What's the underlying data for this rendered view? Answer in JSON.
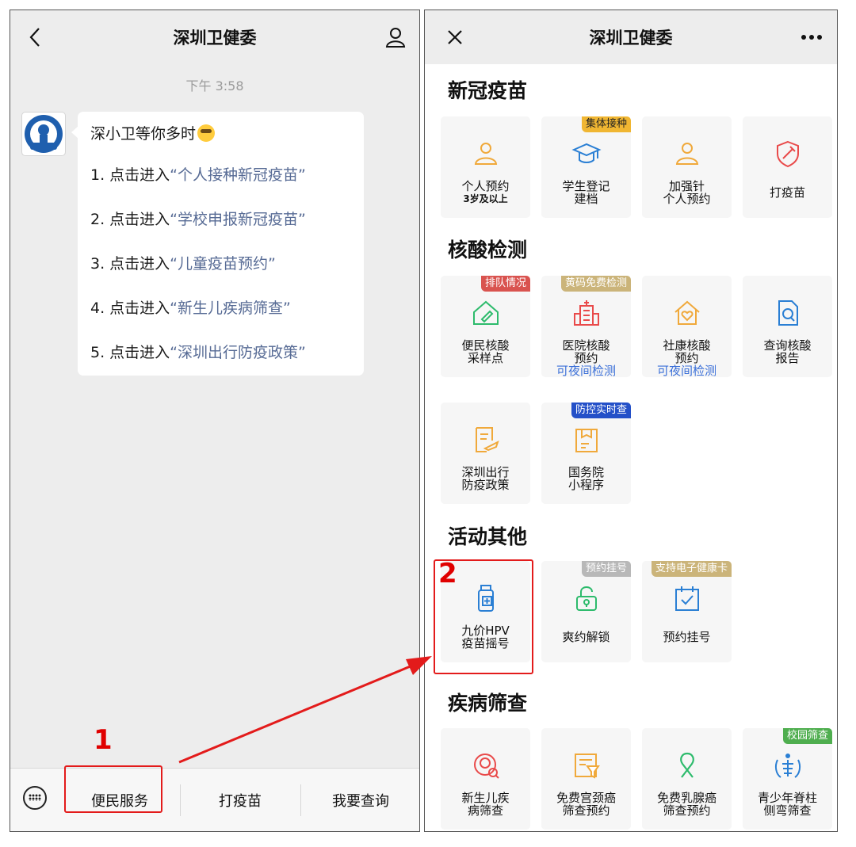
{
  "colors": {
    "accent_red": "#e31b1b",
    "link_blue": "#576b95",
    "icon_orange": "#f0a93b",
    "icon_blue": "#2a7fd4",
    "icon_red": "#e94a4a",
    "icon_green": "#2dbb6c"
  },
  "left": {
    "title": "深圳卫健委",
    "back_icon": "chevron-left-icon",
    "profile_icon": "person-icon",
    "timestamp": "下午 3:58",
    "message": {
      "greeting": "深小卫等你多时",
      "emoji": "sweat-smile-emoji",
      "lines": [
        {
          "prefix": "1. 点击进入",
          "link": "“个人接种新冠疫苗”"
        },
        {
          "prefix": "2. 点击进入",
          "link": "“学校申报新冠疫苗”"
        },
        {
          "prefix": "3. 点击进入",
          "link": "“儿童疫苗预约”"
        },
        {
          "prefix": "4. 点击进入",
          "link": "“新生儿疾病筛查”"
        },
        {
          "prefix": "5. 点击进入",
          "link": "“深圳出行防疫政策”"
        }
      ]
    },
    "menu": {
      "keyboard_icon": "keyboard-icon",
      "items": [
        "便民服务",
        "打疫苗",
        "我要查询"
      ]
    }
  },
  "right": {
    "title": "深圳卫健委",
    "close_icon": "close-icon",
    "more_icon": "more-icon",
    "sections": [
      {
        "title": "新冠疫苗",
        "tiles": [
          {
            "icon": "person-icon",
            "label": "个人预约",
            "sub": "3岁及以上"
          },
          {
            "icon": "graduation-cap-icon",
            "label": "学生登记",
            "label2": "建档",
            "badge": "集体接种"
          },
          {
            "icon": "person-icon",
            "label": "加强针",
            "label2": "个人预约"
          },
          {
            "icon": "vaccine-shield-icon",
            "label": "打疫苗"
          }
        ]
      },
      {
        "title": "核酸检测",
        "tiles": [
          {
            "icon": "house-pen-icon",
            "label": "便民核酸",
            "label2": "采样点",
            "badge": "排队情况"
          },
          {
            "icon": "hospital-icon",
            "label": "医院核酸",
            "label2": "预约",
            "note": "可夜间检测",
            "badge": "黄码免费检测"
          },
          {
            "icon": "home-heart-icon",
            "label": "社康核酸",
            "label2": "预约",
            "note": "可夜间检测"
          },
          {
            "icon": "document-search-icon",
            "label": "查询核酸",
            "label2": "报告"
          },
          {
            "icon": "travel-document-icon",
            "label": "深圳出行",
            "label2": "防疫政策"
          },
          {
            "icon": "mini-program-icon",
            "label": "国务院",
            "label2": "小程序",
            "badge": "防控实时查"
          }
        ]
      },
      {
        "title": "活动其他",
        "tiles": [
          {
            "icon": "vaccine-bottle-icon",
            "label": "九价HPV",
            "label2": "疫苗摇号"
          },
          {
            "icon": "unlock-icon",
            "label": "爽约解锁",
            "badge": "预约挂号"
          },
          {
            "icon": "calendar-check-icon",
            "label": "预约挂号",
            "badge": "支持电子健康卡"
          }
        ]
      },
      {
        "title": "疾病筛查",
        "tiles": [
          {
            "icon": "baby-search-icon",
            "label": "新生儿疾",
            "label2": "病筛查"
          },
          {
            "icon": "filter-doc-icon",
            "label": "免费宫颈癌",
            "label2": "筛查预约"
          },
          {
            "icon": "ribbon-icon",
            "label": "免费乳腺癌",
            "label2": "筛查预约"
          },
          {
            "icon": "spine-icon",
            "label": "青少年脊柱",
            "label2": "侧弯筛查",
            "badge": "校园筛查"
          }
        ]
      }
    ]
  },
  "annotations": {
    "step1": "1",
    "step2": "2"
  }
}
